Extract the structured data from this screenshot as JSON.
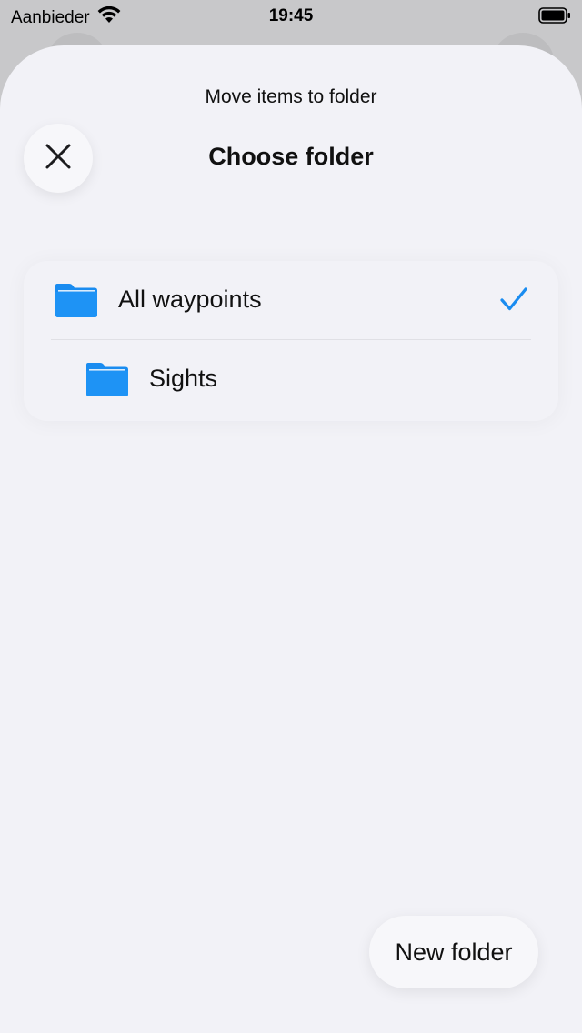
{
  "status_bar": {
    "carrier": "Aanbieder",
    "time": "19:45"
  },
  "sheet": {
    "subtitle": "Move items to folder",
    "title": "Choose folder"
  },
  "folders": [
    {
      "label": "All waypoints",
      "selected": true,
      "icon": "folder-icon"
    },
    {
      "label": "Sights",
      "selected": false,
      "icon": "folder-icon"
    }
  ],
  "actions": {
    "new_folder_label": "New folder"
  },
  "colors": {
    "accent": "#1a8cf0",
    "sheet_background": "#f2f2f7"
  }
}
